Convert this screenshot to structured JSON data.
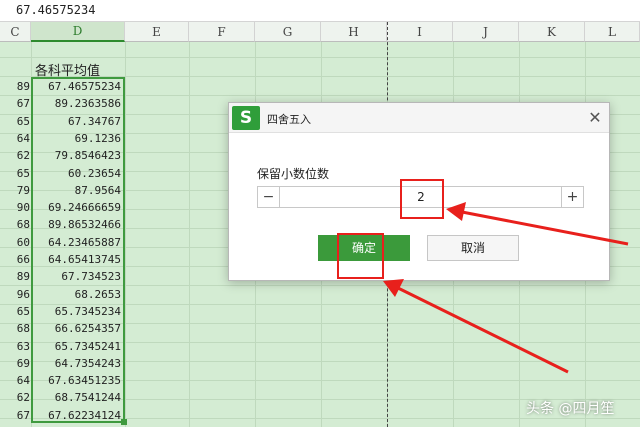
{
  "formula_bar": {
    "value": "67.46575234"
  },
  "columns": [
    {
      "letter": "C",
      "selected": false
    },
    {
      "letter": "D",
      "selected": true
    },
    {
      "letter": "E",
      "selected": false
    },
    {
      "letter": "F",
      "selected": false
    },
    {
      "letter": "G",
      "selected": false
    },
    {
      "letter": "H",
      "selected": false
    },
    {
      "letter": "I",
      "selected": false
    },
    {
      "letter": "J",
      "selected": false
    },
    {
      "letter": "K",
      "selected": false
    },
    {
      "letter": "L",
      "selected": false
    }
  ],
  "sheet": {
    "d_header": "各科平均值",
    "rows": [
      {
        "c": "89",
        "d": "67.46575234"
      },
      {
        "c": "67",
        "d": "89.2363586"
      },
      {
        "c": "65",
        "d": "67.34767"
      },
      {
        "c": "64",
        "d": "69.1236"
      },
      {
        "c": "62",
        "d": "79.8546423"
      },
      {
        "c": "65",
        "d": "60.23654"
      },
      {
        "c": "79",
        "d": "87.9564"
      },
      {
        "c": "90",
        "d": "69.24666659"
      },
      {
        "c": "68",
        "d": "89.86532466"
      },
      {
        "c": "60",
        "d": "64.23465887"
      },
      {
        "c": "66",
        "d": "64.65413745"
      },
      {
        "c": "89",
        "d": "67.734523"
      },
      {
        "c": "96",
        "d": "68.2653"
      },
      {
        "c": "65",
        "d": "65.7345234"
      },
      {
        "c": "68",
        "d": "66.6254357"
      },
      {
        "c": "63",
        "d": "65.7345241"
      },
      {
        "c": "69",
        "d": "64.7354243"
      },
      {
        "c": "64",
        "d": "67.63451235"
      },
      {
        "c": "62",
        "d": "68.7541244"
      },
      {
        "c": "67",
        "d": "67.62234124"
      }
    ]
  },
  "dialog": {
    "logo": "S",
    "title": "四舍五入",
    "close_icon": "close-icon",
    "label": "保留小数位数",
    "minus_label": "−",
    "plus_label": "+",
    "decimal_places": "2",
    "ok_label": "确定",
    "cancel_label": "取消"
  },
  "colors": {
    "accent": "#3b9a3b",
    "annotation": "#e8201c",
    "sheet_bg": "#d4ecd3"
  },
  "watermark": "头条 @四月笙"
}
